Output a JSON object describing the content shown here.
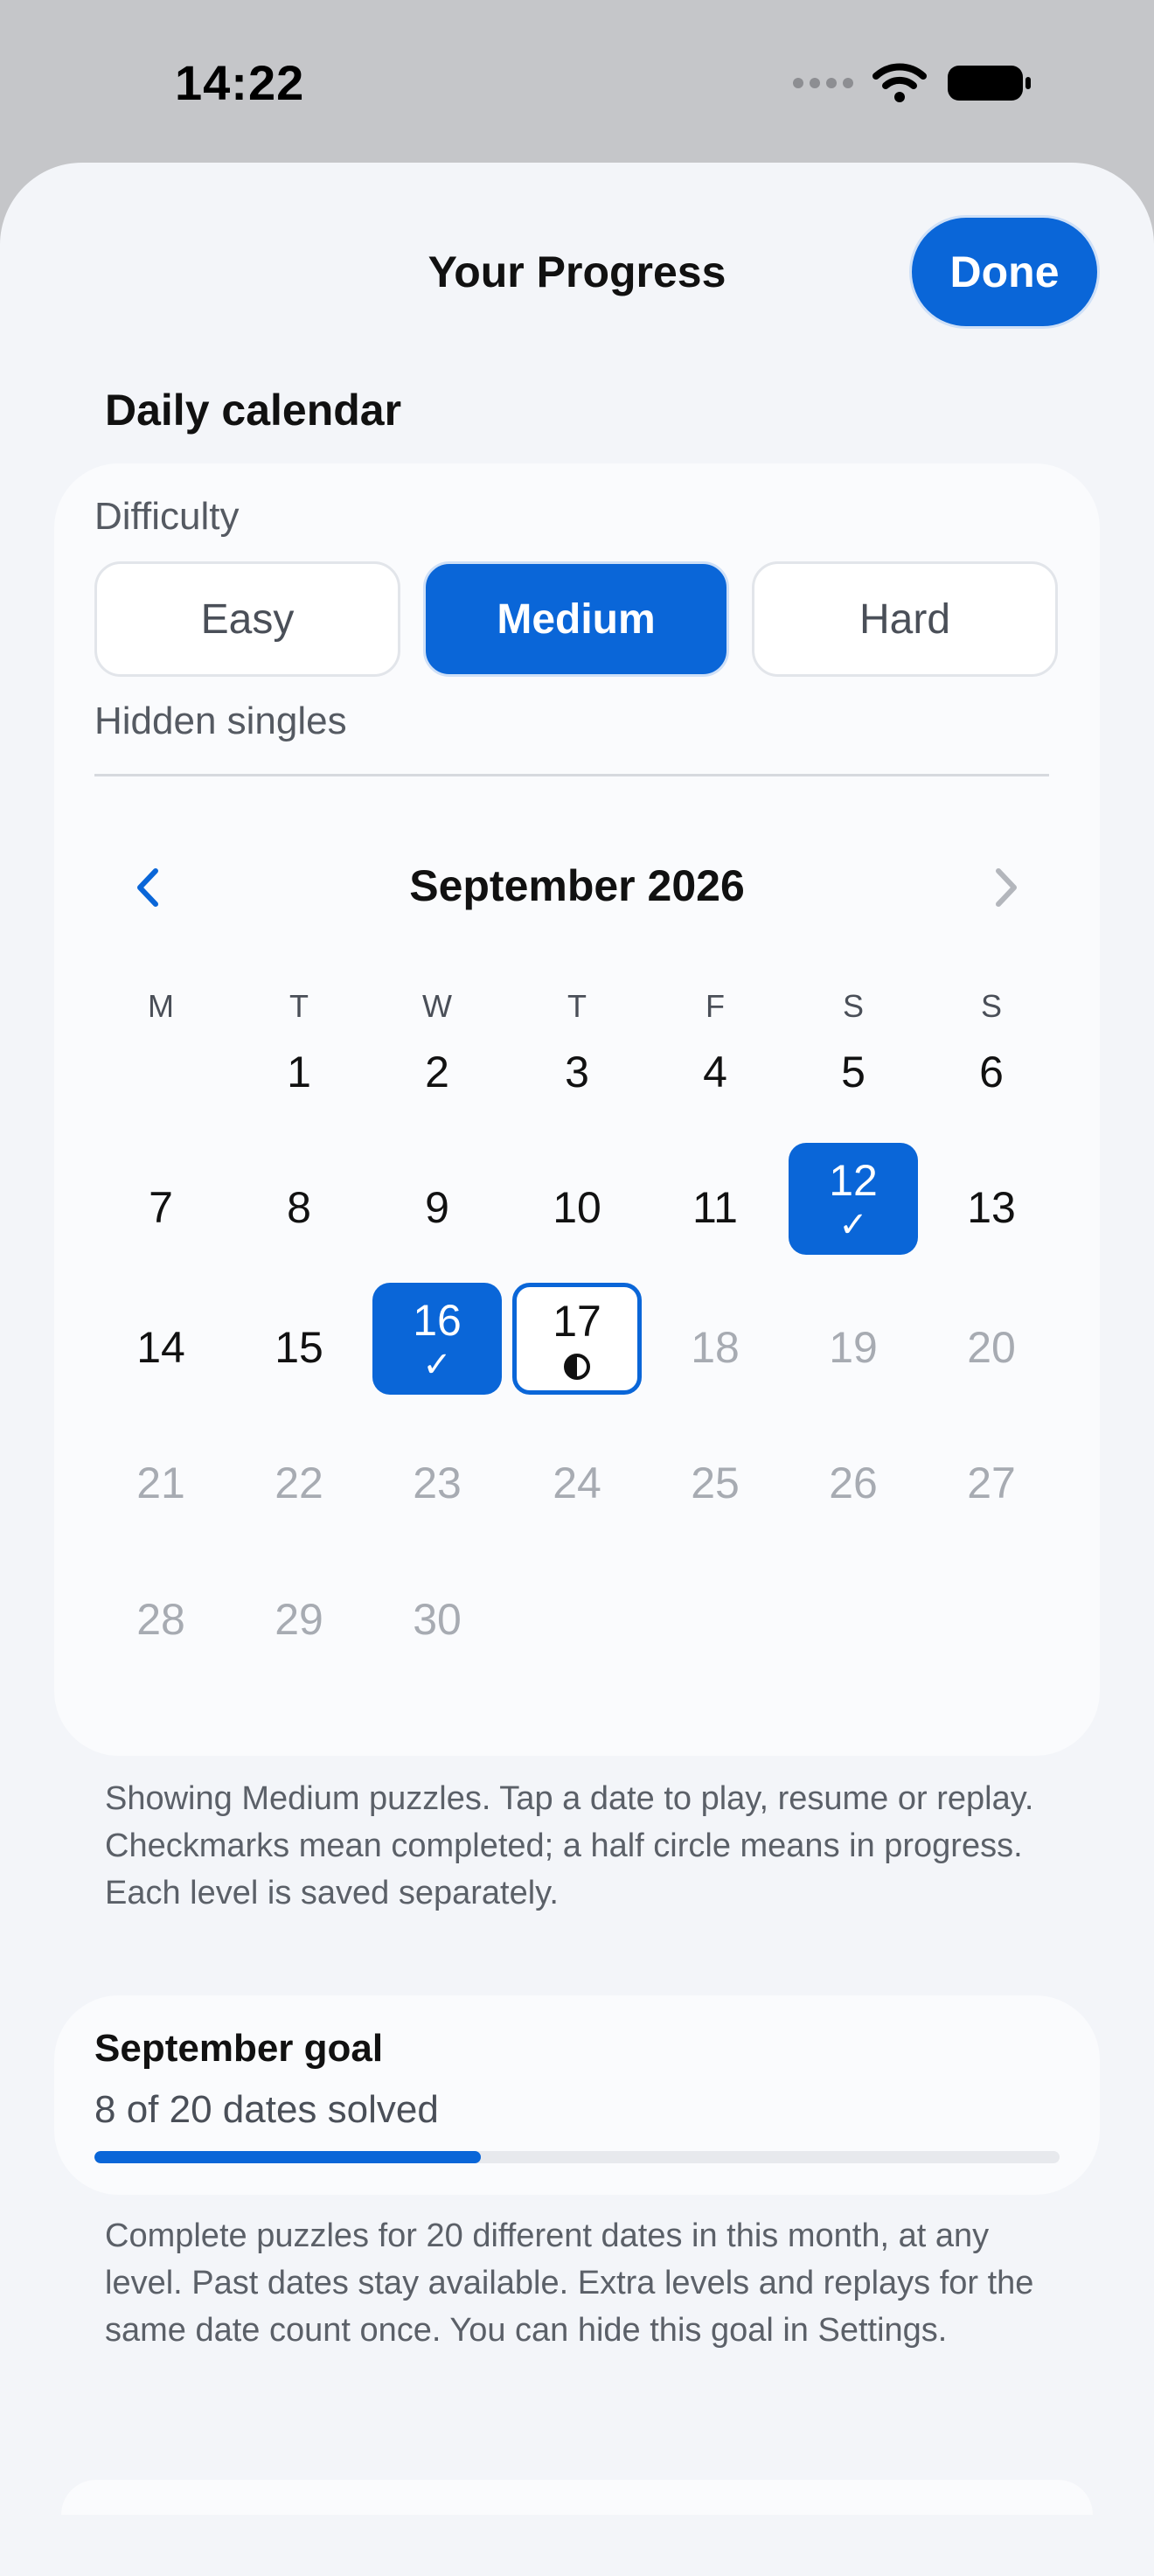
{
  "status_bar": {
    "time": "14:22"
  },
  "header": {
    "title": "Your Progress",
    "done_label": "Done"
  },
  "calendar_section": {
    "title": "Daily calendar",
    "difficulty_label": "Difficulty",
    "difficulties": [
      "Easy",
      "Medium",
      "Hard"
    ],
    "selected_difficulty": "Medium",
    "subtitle": "Hidden singles",
    "month": "September 2026",
    "weekdays": [
      "M",
      "T",
      "W",
      "T",
      "F",
      "S",
      "S"
    ],
    "first_weekday_index": 1,
    "days_in_month": 30,
    "today": 17,
    "completed_days": [
      12,
      16
    ],
    "in_progress_days": [
      17
    ],
    "completed_mark": "✓",
    "help_text": "Showing Medium puzzles. Tap a date to play, resume or replay. Checkmarks mean completed; a half circle means in progress. Each level is saved separately."
  },
  "goal": {
    "title": "September goal",
    "count_text": "8 of 20 dates solved",
    "solved": 8,
    "target": 20,
    "help_text": "Complete puzzles for 20 different dates in this month, at any level. Past dates stay available. Extra levels and replays for the same date count once. You can hide this goal in Settings."
  },
  "colors": {
    "accent": "#0a66d8",
    "future_text": "#a7abb2"
  }
}
